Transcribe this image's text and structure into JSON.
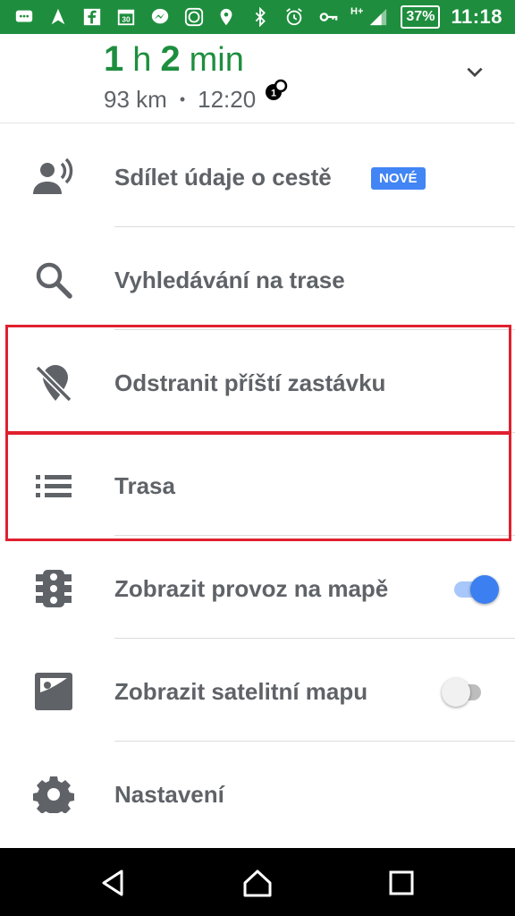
{
  "status_bar": {
    "time": "11:18",
    "battery": "37%",
    "network": "H+",
    "left_icons": [
      "chat-bubble-icon",
      "navigation-arrow-icon",
      "facebook-icon",
      "calendar-icon",
      "messenger-icon",
      "mi-app-icon"
    ],
    "right_icons": [
      "location-icon",
      "bluetooth-icon",
      "alarm-icon",
      "vpn-key-icon",
      "signal-icon"
    ]
  },
  "header": {
    "duration_h": "1",
    "h_unit": "h",
    "duration_min": "2",
    "min_unit": "min",
    "distance": "93 km",
    "separator": "•",
    "arrival": "12:20"
  },
  "menu": [
    {
      "label": "Sdílet údaje o cestě",
      "icon": "share-trip-icon",
      "badge": "NOVÉ"
    },
    {
      "label": "Vyhledávání na trase",
      "icon": "search-icon"
    },
    {
      "label": "Odstranit příští zastávku",
      "icon": "remove-stop-icon"
    },
    {
      "label": "Trasa",
      "icon": "route-list-icon"
    },
    {
      "label": "Zobrazit provoz na mapě",
      "icon": "traffic-light-icon",
      "toggle": true
    },
    {
      "label": "Zobrazit satelitní mapu",
      "icon": "satellite-image-icon",
      "toggle": false
    },
    {
      "label": "Nastavení",
      "icon": "settings-gear-icon"
    }
  ],
  "colors": {
    "brand_green": "#1e8e3e",
    "highlight_red": "#e0202f",
    "toggle_blue": "#3c7ff0",
    "badge_blue": "#4285f4"
  },
  "nav_bar": [
    "back-icon",
    "home-icon",
    "recents-icon"
  ]
}
